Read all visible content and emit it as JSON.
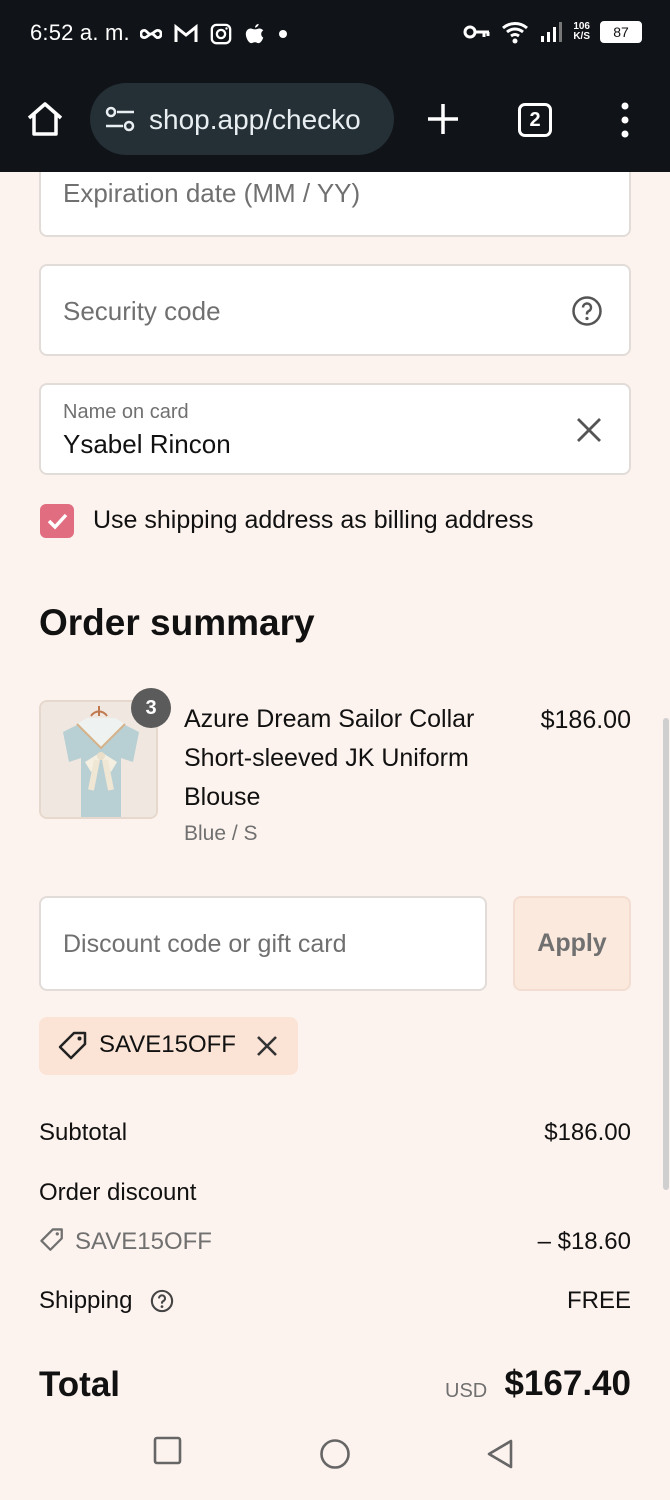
{
  "status_bar": {
    "time": "6:52 a. m.",
    "net_speed_top": "106",
    "net_speed_bottom": "K/S",
    "battery": "87",
    "icons": [
      "infinity-icon",
      "gmail-icon",
      "instagram-icon",
      "apple-icon",
      "dot-icon",
      "key-icon",
      "wifi-icon",
      "signal-icon",
      "battery-icon"
    ]
  },
  "browser": {
    "url": "shop.app/checko",
    "tab_count": "2",
    "icons": [
      "home-icon",
      "tune-icon",
      "plus-icon",
      "tabs-icon",
      "more-vert-icon"
    ]
  },
  "payment_form": {
    "expiration_placeholder": "Expiration date (MM / YY)",
    "security_placeholder": "Security code",
    "name_label": "Name on card",
    "name_value": "Ysabel Rincon",
    "billing_checkbox_label": "Use shipping address as billing address",
    "billing_checked": true
  },
  "order_summary": {
    "title": "Order summary",
    "item": {
      "quantity": "3",
      "name": "Azure Dream Sailor Collar Short-sleeved JK Uniform Blouse",
      "variant": "Blue / S",
      "price": "$186.00"
    },
    "discount_placeholder": "Discount code or gift card",
    "apply_label": "Apply",
    "applied_code": "SAVE15OFF",
    "subtotal_label": "Subtotal",
    "subtotal_value": "$186.00",
    "order_discount_label": "Order discount",
    "discount_code": "SAVE15OFF",
    "discount_value": "– $18.60",
    "shipping_label": "Shipping",
    "shipping_value": "FREE",
    "total_label": "Total",
    "currency": "USD",
    "total_value": "$167.40"
  },
  "colors": {
    "page_bg": "#fdf3ee",
    "checkbox_accent": "#e06e80",
    "chip_bg": "#fbe4d6",
    "topbar_bg": "#101418"
  }
}
